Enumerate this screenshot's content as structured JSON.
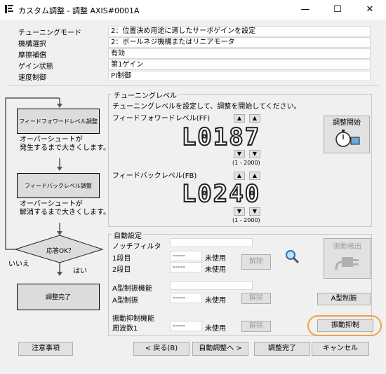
{
  "window": {
    "title": "カスタム調整 - 調整 AXIS#0001A",
    "minimize": "—",
    "maximize": "☐",
    "close": "✕"
  },
  "info_rows": [
    {
      "label": "チューニングモード",
      "value": "2：位置決め用途に適したサーボゲインを設定"
    },
    {
      "label": "機構選択",
      "value": "2：ボールネジ機構またはリニアモータ"
    },
    {
      "label": "摩擦補償",
      "value": "有効"
    },
    {
      "label": "ゲイン状態",
      "value": "第1ゲイン"
    },
    {
      "label": "速度制御",
      "value": "PI制御"
    }
  ],
  "flow": {
    "step1": "フィードフォワードレベル調整",
    "note1": "オーバーシュートが\n発生するまで大きくします。",
    "step2": "フィードバックレベル調整",
    "note2": "オーバーシュートが\n解消するまで大きくします。",
    "decision": "応答OK？",
    "no_label": "いいえ",
    "yes_label": "はい",
    "done": "調整完了"
  },
  "tuning": {
    "group_title": "チューニングレベル",
    "instruction": "チューニングレベルを設定して、調整を開始してください。",
    "ff_label": "フィードフォワードレベル(FF)",
    "ff_display": "L0187",
    "ff_range": "(1 - 2000)",
    "fb_label": "フィードバックレベル(FB)",
    "fb_display": "L0240",
    "fb_range": "(1 - 2000)",
    "start_label": "調整開始"
  },
  "auto": {
    "group_title": "自動設定",
    "notch_label": "ノッチフィルタ",
    "stage1": "1段目",
    "stage2": "2段目",
    "dash": "-----",
    "unused": "未使用",
    "release": "解除",
    "detect_label": "振動検出",
    "atype_title": "A型制振機能",
    "atype_row": "A型制振",
    "atype_button": "A型制振",
    "supp_title": "振動抑制機能",
    "supp_row": "周波数1",
    "supp_button": "振動抑制"
  },
  "footer": {
    "notes": "注意事項",
    "back": "< 戻る(B)",
    "next": "自動調整へ >",
    "complete": "調整完了",
    "cancel": "キャンセル"
  },
  "colors": {
    "highlight": "#f0a040",
    "segment_outline": "#222222"
  },
  "arrows": {
    "up": "▲",
    "down": "▼"
  }
}
